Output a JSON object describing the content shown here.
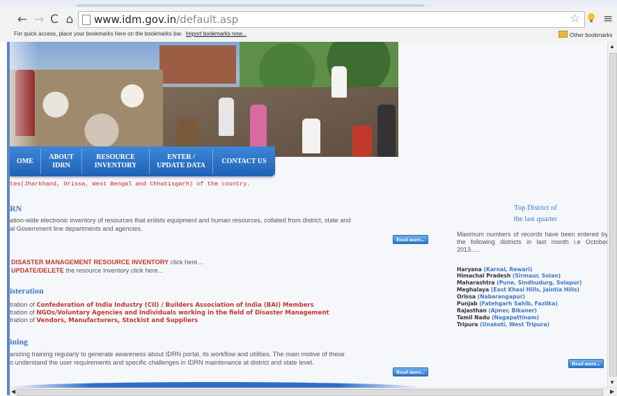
{
  "browser": {
    "url_host": "www.idm.gov.in",
    "url_path": "/default.asp",
    "bookmarks_message": "For quick access, place your bookmarks here on the bookmarks bar.",
    "import_link": "Import bookmarks now...",
    "other_bookmarks": "Other bookmarks",
    "icons": [
      "back-icon",
      "forward-icon",
      "reload-icon",
      "home-icon",
      "page-icon",
      "star-icon",
      "bulb-icon",
      "menu-icon"
    ]
  },
  "nav": {
    "items": [
      {
        "label": "OME"
      },
      {
        "label": "ABOUT\nIDRN"
      },
      {
        "label": "RESOURCE\nINVENTORY"
      },
      {
        "label": "ENTER /\nUPDATE DATA"
      },
      {
        "label": "CONTACT US"
      }
    ]
  },
  "marquee": "tes(Jharkhand, Orissa, West Bengal and Chhatisgarh) of the country.",
  "idrn": {
    "heading": "RN",
    "line1": "ation-wide electronic inventory of resources that enlists equipment and human resources, collated from district, state and",
    "line2": "al Government line departments and agencies.",
    "read_more": "Read more..."
  },
  "inventory": {
    "line1_link": "DISASTER MANAGEMENT RESOURCE INVENTORY",
    "line1_rest": " click here...",
    "line2_link": "UPDATE/DELETE",
    "line2_rest": "  the resource inventory click here..."
  },
  "registration": {
    "heading": "isteration",
    "rows": [
      {
        "prefix": "tration of ",
        "link": "Confederation of India Industry (CII) / Builders Association of India (BAI) Members"
      },
      {
        "prefix": "tration of ",
        "link": "NGOs/Voluntary Agencies and Individuals working in the field of Disaster Management"
      },
      {
        "prefix": "tration of ",
        "link": "Vendors, Manufacturers, Stockist and Suppliers"
      }
    ]
  },
  "training": {
    "heading": "ining",
    "line1": "anizing training regularly to generate awareness about IDRN portal, its workflow and utilities. The main motive of these",
    "line2": "o understand the user requirements and specific challenges in IDRN maintenance at district and state level.",
    "read_more": "Read more..."
  },
  "top_district": {
    "title_line1": "Top District of",
    "title_line2": "the last quarter",
    "desc": "Maximum numbers of records have been entered by the following districts in last month i.e October 2013.....",
    "states": [
      {
        "state": "Haryana",
        "districts": "(Karnal, Rewari)"
      },
      {
        "state": "Himachal Pradesh",
        "districts": "(Sirmaur, Solan)"
      },
      {
        "state": "Maharashtra",
        "districts": "(Pune, Sindhudurg, Solapur)"
      },
      {
        "state": "Meghalaya",
        "districts": "(East Khasi Hills, Jaintia Hills)"
      },
      {
        "state": "Orissa",
        "districts": "(Nabarangapur)"
      },
      {
        "state": "Punjab",
        "districts": "(Fatehgarh Sahib, Fazilka)"
      },
      {
        "state": "Rajasthan",
        "districts": "(Ajmer, Bikaner)"
      },
      {
        "state": "Tamil Nadu",
        "districts": "(Nagapattinam)"
      },
      {
        "state": "Tripura",
        "districts": "(Unakoti, West Tripura)"
      }
    ],
    "read_more": "Read more..."
  },
  "colors": {
    "accent": "#3f78c2",
    "link_red": "#c0392b",
    "nav_blue": "#2e6ec8",
    "marquee_red": "#d21f1f"
  }
}
